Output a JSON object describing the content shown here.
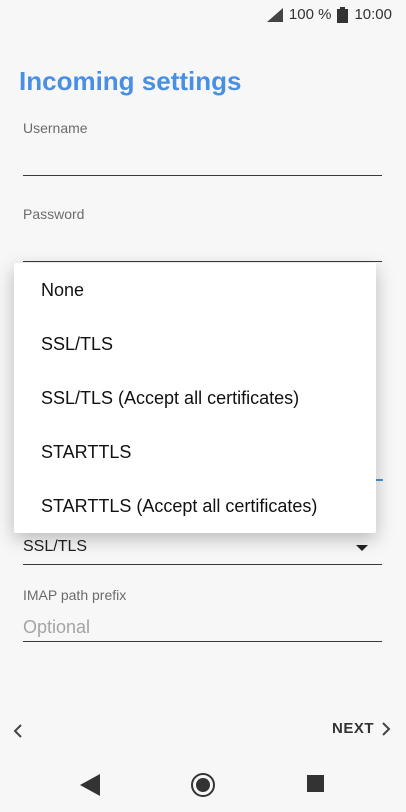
{
  "status": {
    "battery_text": "100 %",
    "time": "10:00"
  },
  "page": {
    "title": "Incoming settings"
  },
  "username": {
    "label": "Username"
  },
  "password": {
    "label": "Password"
  },
  "security": {
    "selected": "SSL/TLS"
  },
  "imap": {
    "label": "IMAP path prefix",
    "placeholder": "Optional"
  },
  "menu": {
    "items": [
      {
        "label": "None"
      },
      {
        "label": "SSL/TLS"
      },
      {
        "label": "SSL/TLS (Accept all certificates)"
      },
      {
        "label": "STARTTLS"
      },
      {
        "label": "STARTTLS (Accept all certificates)"
      }
    ]
  },
  "nav": {
    "next_label": "NEXT"
  },
  "colors": {
    "accent": "#4a90e2"
  }
}
